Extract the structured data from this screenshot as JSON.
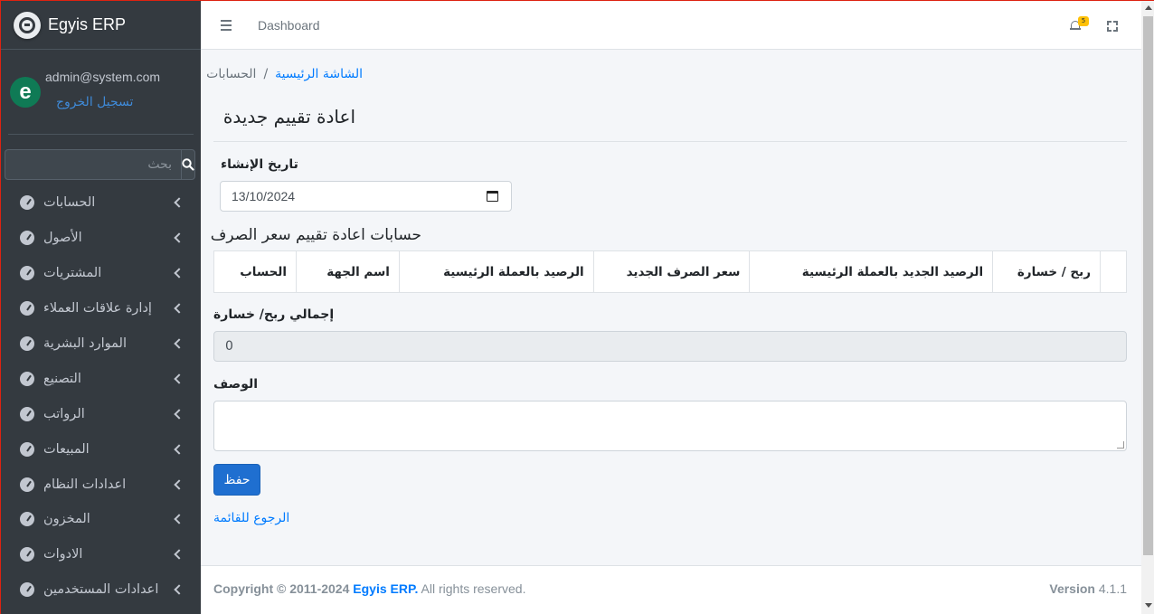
{
  "sidebar": {
    "brand": "Egyis ERP",
    "user_email": "admin@system.com",
    "logout": "تسجيل الخروج",
    "search_placeholder": "بحث",
    "items": [
      {
        "label": "الحسابات"
      },
      {
        "label": "الأصول"
      },
      {
        "label": "المشتريات"
      },
      {
        "label": "إدارة علاقات العملاء"
      },
      {
        "label": "الموارد البشرية"
      },
      {
        "label": "التصنيع"
      },
      {
        "label": "الرواتب"
      },
      {
        "label": "المبيعات"
      },
      {
        "label": "اعدادات النظام"
      },
      {
        "label": "المخزون"
      },
      {
        "label": "الادوات"
      },
      {
        "label": "اعدادات المستخدمين"
      }
    ]
  },
  "topbar": {
    "dashboard": "Dashboard",
    "notification_count": "5"
  },
  "breadcrumb": {
    "home": "الشاشة الرئيسية",
    "separator": "/",
    "current": "الحسابات"
  },
  "page": {
    "title": "اعادة تقييم جديدة",
    "date_label": "تاريخ الإنشاء",
    "date_value": "13/10/2024",
    "section_title": "حسابات اعادة تقييم سعر الصرف",
    "table_headers": [
      "",
      "ربح / خسارة",
      "الرصيد الجديد بالعملة الرئيسية",
      "سعر الصرف الجديد",
      "الرصيد بالعملة الرئيسية",
      "اسم الجهة",
      "الحساب"
    ],
    "total_label": "إجمالي ربح/ خسارة",
    "total_value": "0",
    "description_label": "الوصف",
    "save": "حفظ",
    "back": "الرجوع للقائمة"
  },
  "footer": {
    "copyright_prefix": "Copyright © 2011-2024",
    "brand": "Egyis ERP.",
    "rights": "All rights reserved.",
    "version_label": "Version",
    "version_value": "4.1.1"
  }
}
